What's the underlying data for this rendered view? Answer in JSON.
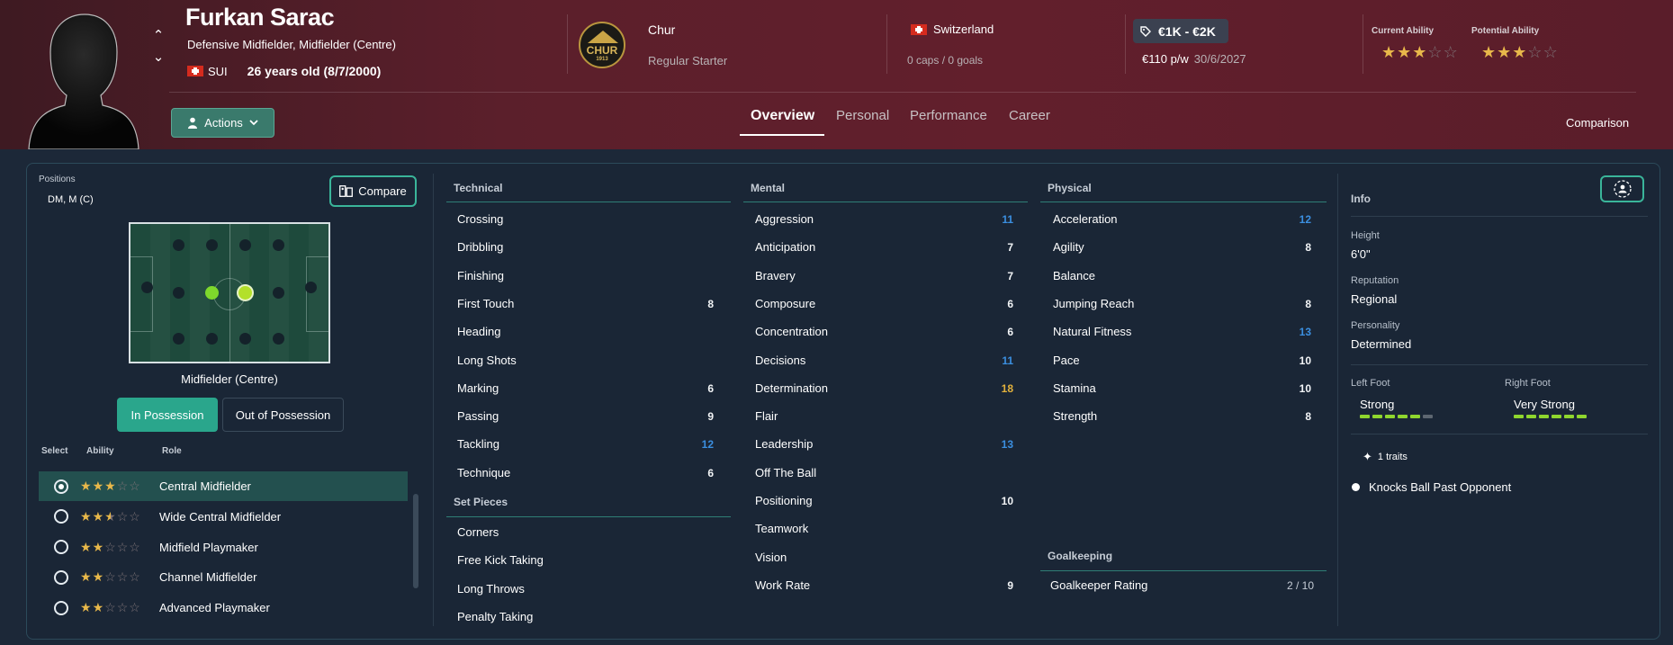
{
  "header": {
    "name": "Furkan Sarac",
    "positions": "Defensive Midfielder, Midfielder (Centre)",
    "nationality_code": "SUI",
    "age": "26 years old (8/7/2000)",
    "club_name": "Chur",
    "club_badge_text": "CHUR",
    "club_badge_year": "1913",
    "squad_status": "Regular Starter",
    "nation": "Switzerland",
    "caps": "0 caps / 0 goals",
    "value": "€1K - €2K",
    "wage": "€110 p/w",
    "contract_end": "30/6/2027",
    "current_ability_label": "Current Ability",
    "current_ability_stars": 3,
    "potential_ability_label": "Potential Ability",
    "potential_ability_stars": 3,
    "actions_label": "Actions",
    "tabs": [
      "Overview",
      "Personal",
      "Performance",
      "Career"
    ],
    "active_tab": "Overview",
    "comparison_label": "Comparison",
    "colors": {
      "header_bg": "#5b1f2b",
      "accent": "#2aa68c",
      "star": "#e8b84a"
    }
  },
  "left": {
    "positions_label": "Positions",
    "positions_value": "DM, M (C)",
    "compare_label": "Compare",
    "role_label": "Midfielder (Centre)",
    "in_possession": "In Possession",
    "out_of_possession": "Out of Possession",
    "col_select": "Select",
    "col_ability": "Ability",
    "col_role": "Role",
    "roles": [
      {
        "name": "Central Midfielder",
        "stars": 3,
        "selected": true
      },
      {
        "name": "Wide Central Midfielder",
        "stars": 2.5,
        "selected": false
      },
      {
        "name": "Midfield Playmaker",
        "stars": 2,
        "selected": false
      },
      {
        "name": "Channel Midfielder",
        "stars": 2,
        "selected": false
      },
      {
        "name": "Advanced Playmaker",
        "stars": 2,
        "selected": false
      }
    ]
  },
  "technical": {
    "title": "Technical",
    "items": [
      {
        "name": "Crossing",
        "value": ""
      },
      {
        "name": "Dribbling",
        "value": ""
      },
      {
        "name": "Finishing",
        "value": ""
      },
      {
        "name": "First Touch",
        "value": "8"
      },
      {
        "name": "Heading",
        "value": ""
      },
      {
        "name": "Long Shots",
        "value": ""
      },
      {
        "name": "Marking",
        "value": "6"
      },
      {
        "name": "Passing",
        "value": "9"
      },
      {
        "name": "Tackling",
        "value": "12"
      },
      {
        "name": "Technique",
        "value": "6"
      }
    ]
  },
  "set_pieces": {
    "title": "Set Pieces",
    "items": [
      "Corners",
      "Free Kick Taking",
      "Long Throws",
      "Penalty Taking"
    ]
  },
  "mental": {
    "title": "Mental",
    "items": [
      {
        "name": "Aggression",
        "value": "11"
      },
      {
        "name": "Anticipation",
        "value": "7"
      },
      {
        "name": "Bravery",
        "value": "7"
      },
      {
        "name": "Composure",
        "value": "6"
      },
      {
        "name": "Concentration",
        "value": "6"
      },
      {
        "name": "Decisions",
        "value": "11"
      },
      {
        "name": "Determination",
        "value": "18"
      },
      {
        "name": "Flair",
        "value": ""
      },
      {
        "name": "Leadership",
        "value": "13"
      },
      {
        "name": "Off The Ball",
        "value": ""
      },
      {
        "name": "Positioning",
        "value": "10"
      },
      {
        "name": "Teamwork",
        "value": ""
      },
      {
        "name": "Vision",
        "value": ""
      },
      {
        "name": "Work Rate",
        "value": "9"
      }
    ]
  },
  "physical": {
    "title": "Physical",
    "items": [
      {
        "name": "Acceleration",
        "value": "12"
      },
      {
        "name": "Agility",
        "value": "8"
      },
      {
        "name": "Balance",
        "value": ""
      },
      {
        "name": "Jumping Reach",
        "value": "8"
      },
      {
        "name": "Natural Fitness",
        "value": "13"
      },
      {
        "name": "Pace",
        "value": "10"
      },
      {
        "name": "Stamina",
        "value": "10"
      },
      {
        "name": "Strength",
        "value": "8"
      }
    ]
  },
  "goalkeeping": {
    "title": "Goalkeeping",
    "rating_label": "Goalkeeper Rating",
    "rating_value": "2 / 10"
  },
  "info": {
    "title": "Info",
    "height_label": "Height",
    "height": "6'0\"",
    "reputation_label": "Reputation",
    "reputation": "Regional",
    "personality_label": "Personality",
    "personality": "Determined",
    "left_foot_label": "Left Foot",
    "left_foot": "Strong",
    "left_foot_level": 5,
    "right_foot_label": "Right Foot",
    "right_foot": "Very Strong",
    "right_foot_level": 6,
    "traits_count": "1 traits",
    "traits": [
      "Knocks Ball Past Opponent"
    ]
  }
}
